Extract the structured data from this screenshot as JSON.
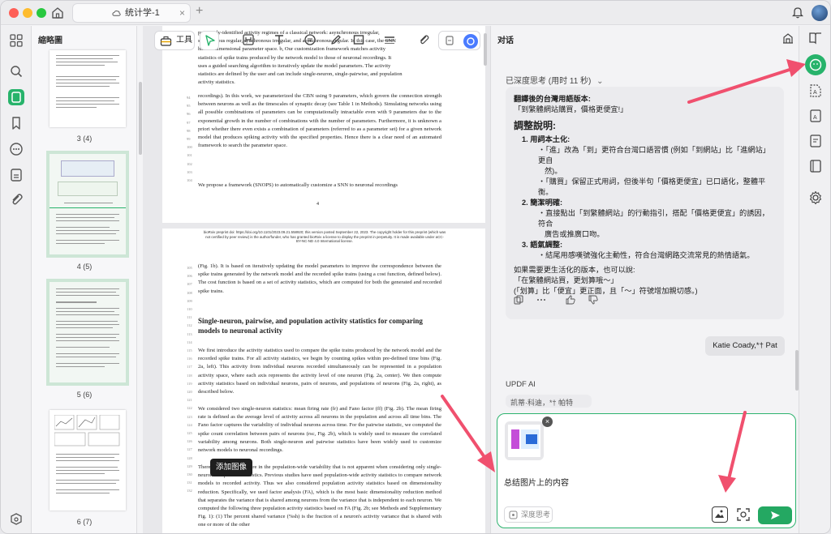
{
  "window": {
    "tab_title": "统计学-1",
    "tab_close": "×",
    "tab_add": "+"
  },
  "thumbnails": {
    "title": "縮略圖",
    "pages": [
      {
        "label": "3 (4)"
      },
      {
        "label": "4 (5)"
      },
      {
        "label": "5 (6)"
      },
      {
        "label": "6 (7)"
      }
    ]
  },
  "toolbar": {
    "tools_label": "工具"
  },
  "document": {
    "page1_lines": [
      "previously-identified activity regimes of a classical network: asynchronous irregular,",
      "synchronous regular, synchronous irregular, and asynchronous regular. In this case, the SNN",
      "has a 9-dimensional parameter space. b, Our customization framework matches activity",
      "statistics of spike trains produced by the network model to those of neuronal recordings. It",
      "uses a guided searching algorithm to iteratively update the model parameters. The activity",
      "statistics are defined by the user and can include single-neuron, single-pairwise, and population",
      "activity statistics."
    ],
    "page1_para2": "recordings). In this work, we parameterized the CBN using 9 parameters, which govern the connection strength between neurons as well as the timescales of synaptic decay (see Table 1 in Methods). Simulating networks using all possible combinations of parameters can be computationally intractable even with 9 parameters due to the exponential growth in the number of combinations with the number of parameters. Furthermore, it is unknown a priori whether there even exists a combination of parameters (referred to as a parameter set) for a given network model that produces spiking activity with the specified properties. Hence there is a clear need of an automated framework to search the parameter space.",
    "page1_para3": "We propose a framework (SNOPS) to automatically customize a SNN to neuronal recordings",
    "page1_number": "4",
    "banner": "bioRxiv preprint doi: https://doi.org/10.1101/2023.09.21.558920; this version posted September 22, 2023. The copyright holder for this preprint (which was not certified by peer review) is the author/funder, who has granted bioRxiv a license to display the preprint in perpetuity. It is made available under aCC-BY-NC-ND 4.0 International license.",
    "page2_para1": "(Fig. 1b). It is based on iteratively updating the model parameters to improve the correspondence between the spike trains generated by the network model and the recorded spike trains (using a cost function, defined below). The cost function is based on a set of activity statistics, which are computed for both the generated and recorded spike trains.",
    "page2_heading": "Single-neuron, pairwise, and population activity statistics for comparing models to neuronal activity",
    "page2_para2": "We first introduce the activity statistics used to compare the spike trains produced by the network model and the recorded spike trains. For all activity statistics, we begin by counting spikes within pre-defined time bins (Fig. 2a, left). This activity from individual neurons recorded simultaneously can be represented in a population activity space, where each axis represents the activity level of one neuron (Fig. 2a, center). We then compute activity statistics based on individual neurons, pairs of neurons, and populations of neurons (Fig. 2a, right), as described below.",
    "page2_para3": "We considered two single-neuron statistics: mean firing rate (fr) and Fano factor (ff) (Fig. 2b). The mean firing rate is defined as the average level of activity across all neurons in the population and across all time bins. The Fano factor captures the variability of individual neurons across time. For the pairwise statistic, we computed the spike count correlation between pairs of neurons (rsc, Fig. 2b), which is widely used to measure the correlated variability among neurons. Both single-neuron and pairwise statistics have been widely used to customize network models to neuronal recordings.",
    "page2_para4": "There can also be structure in the population-wide variability that is not apparent when considering only single-neuron and pairwise statistics. Previous studies have used population-wide activity statistics to compare network models to recorded activity. Thus we also considered population activity statistics based on dimensionality reduction. Specifically, we used factor analysis (FA), which is the most basic dimensionality reduction method that separates the variance that is shared among neurons from the variance that is independent to each neuron. We computed the following three population activity statistics based on FA (Fig. 2b; see Methods and Supplementary Fig. 1): (1) The percent shared variance (%sh) is the fraction of a neuron's activity variance that is shared with one or more of the other",
    "line_numbers_p1": [
      "94",
      "95",
      "96",
      "97",
      "98",
      "99",
      "100",
      "101",
      "102",
      "103",
      "104"
    ],
    "line_numbers_p2": [
      "105",
      "106",
      "107",
      "108",
      "109",
      "110",
      "111",
      "112",
      "113",
      "114",
      "115",
      "116",
      "117",
      "118",
      "119",
      "120",
      "121",
      "122",
      "123",
      "124",
      "125",
      "126",
      "127",
      "128",
      "129",
      "130",
      "131",
      "132"
    ]
  },
  "chat": {
    "title": "对话",
    "thinking_status": "已深度思考 (用时 11 秒)",
    "answer": {
      "translated_title": "翻譯後的台灣用語版本:",
      "translated_text": "「到繁體網站購買，價格更便宜!」",
      "explain_title": "調整說明:",
      "points": [
        {
          "head": "1. 用詞本土化:",
          "subs": [
            "・「進」改為「到」更符合台灣口語習慣 (例如「到網站」比「進網站」更自",
            "然)。",
            "・「購買」保留正式用詞，但後半句「價格更便宜」已口語化，整體平衡。"
          ]
        },
        {
          "head": "2. 簡潔明確:",
          "subs": [
            "・直接點出「到繁體網站」的行動指引，搭配「價格更便宜」的誘因，符合",
            "廣告或推廣口吻。"
          ]
        },
        {
          "head": "3. 語氣調整:",
          "subs": [
            "・結尾用感嘆號強化主動性，符合台灣網路交流常見的熱情語氣。"
          ]
        }
      ],
      "alt_intro": "如果需要更生活化的版本，也可以說:",
      "alt_text": "「在繁體網站買，更划算哦～」",
      "alt_note": "(「划算」比「便宜」更正面，且「～」符號增加親切感。)"
    },
    "user_message": "Katie Coady,*† Pat",
    "ai_label": "UPDF AI",
    "ai_stub": "凯蒂·科迪，*† 帕特",
    "input_text": "总结图片上的内容",
    "deep_think_label": "深度思考",
    "tooltip": "添加图像"
  },
  "colors": {
    "accent_green": "#27b36b",
    "send_green": "#24a862",
    "arrow_red": "#f0506e"
  }
}
